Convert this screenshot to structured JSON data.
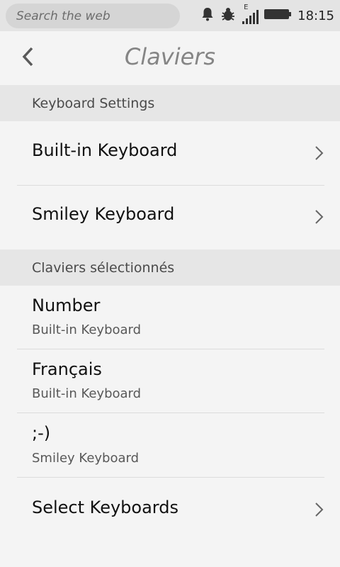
{
  "status_bar": {
    "search_placeholder": "Search the web",
    "network_label": "E",
    "time": "18:15",
    "icons": [
      "bell-icon",
      "bug-icon",
      "signal-icon",
      "battery-icon"
    ]
  },
  "header": {
    "title": "Claviers",
    "back_icon": "chevron-left-icon"
  },
  "sections": [
    {
      "label": "Keyboard Settings",
      "items": [
        {
          "title": "Built-in Keyboard"
        },
        {
          "title": "Smiley Keyboard"
        }
      ]
    },
    {
      "label": "Claviers sélectionnés",
      "items": [
        {
          "title": "Number",
          "subtitle": "Built-in Keyboard"
        },
        {
          "title": "Français",
          "subtitle": "Built-in Keyboard"
        },
        {
          "title": ";-)",
          "subtitle": "Smiley Keyboard"
        },
        {
          "title": "Select Keyboards"
        }
      ]
    }
  ],
  "colors": {
    "background": "#f4f4f4",
    "section_header": "#e6e6e6",
    "title_gray": "#858585"
  }
}
